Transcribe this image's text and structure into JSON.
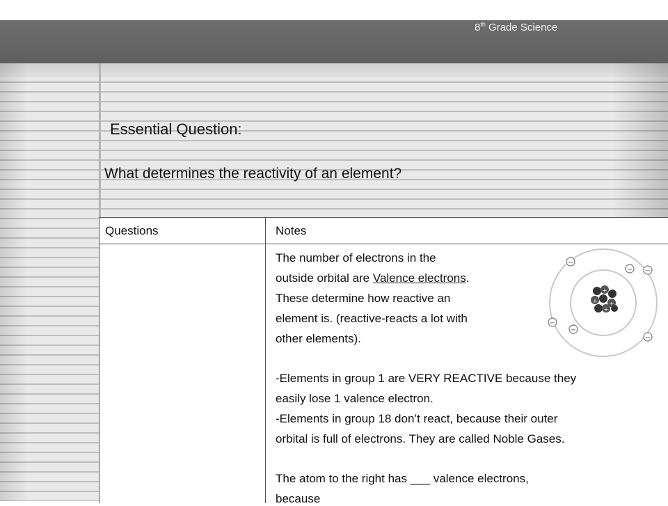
{
  "header": {
    "grade_prefix": "8",
    "grade_sup": "th",
    "grade_suffix": " Grade Science"
  },
  "essential_question": {
    "label": "Essential Question:",
    "text": "What determines the reactivity of an element?"
  },
  "table": {
    "col_questions": "Questions",
    "col_notes": "Notes"
  },
  "notes": {
    "p1_l1": "The number of electrons in the",
    "p1_l2_a": "outside orbital are ",
    "p1_l2_u": "Valence electrons",
    "p1_l2_b": ".",
    "p1_l3": "These determine how reactive an",
    "p1_l4": "element is. (reactive-reacts a lot with",
    "p1_l5": "other elements).",
    "p2_l1": "-Elements in group 1 are VERY REACTIVE because they",
    "p2_l2": "easily lose 1 valence electron.",
    "p3_l1": "-Elements in group 18 don’t react, because their outer",
    "p3_l2": "orbital is full of electrons.  They are called Noble Gases.",
    "p4_l1_a": "The atom to the right has ",
    "p4_l1_blank": "___",
    "p4_l1_b": " valence electrons,",
    "p4_l2": "because"
  },
  "atom": {
    "electron_symbol": "−",
    "proton_symbol": "+"
  }
}
